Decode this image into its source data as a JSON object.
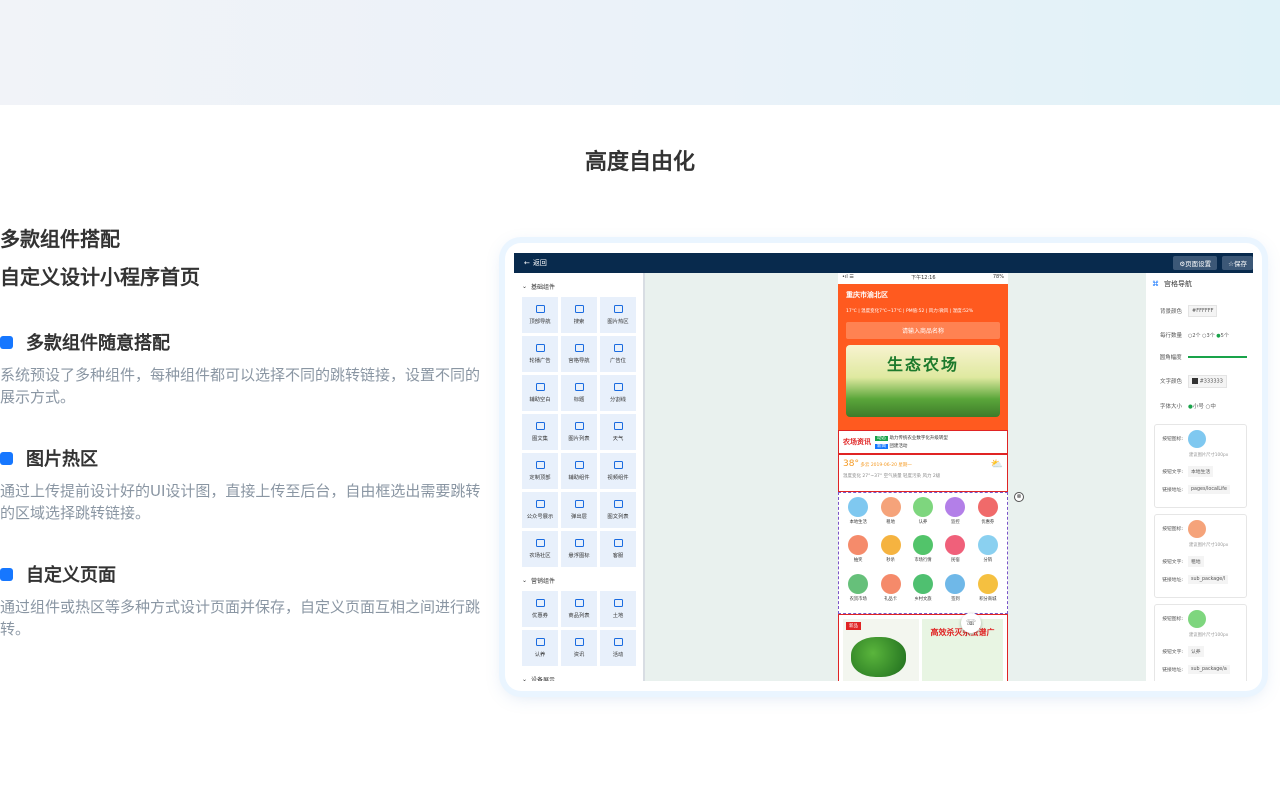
{
  "section": {
    "title": "高度自由化"
  },
  "headline": {
    "line1": "多款组件搭配",
    "line2": "自定义设计小程序首页"
  },
  "features": [
    {
      "title": "多款组件随意搭配",
      "desc": "系统预设了多种组件，每种组件都可以选择不同的跳转链接，设置不同的展示方式。"
    },
    {
      "title": "图片热区",
      "desc": "通过上传提前设计好的UI设计图，直接上传至后台，自由框选出需要跳转的区域选择跳转链接。"
    },
    {
      "title": "自定义页面",
      "desc": "通过组件或热区等多种方式设计页面并保存，自定义页面互相之间进行跳转。"
    }
  ],
  "editor": {
    "back_label": "返回",
    "page_settings_label": "⚙页面设置",
    "save_label": "☆保存",
    "groups": [
      {
        "title": "基础组件",
        "items": [
          "顶部导航",
          "搜索",
          "图片热区",
          "轮播广告",
          "宫格导航",
          "广告位",
          "辅助空白",
          "标题",
          "分割线",
          "图文集",
          "图片列表",
          "天气",
          "定制顶部",
          "辅助组件",
          "视频组件",
          "公众号展示",
          "弹出层",
          "图文列表",
          "农场社区",
          "悬浮图标",
          "客服"
        ]
      },
      {
        "title": "营销组件",
        "items": [
          "优惠券",
          "商品列表",
          "土地",
          "认养",
          "资讯",
          "活动"
        ]
      },
      {
        "title": "设备展示",
        "items": []
      }
    ],
    "phone": {
      "status_left": "•ıl ☰",
      "status_time": "下午12:16",
      "status_battery": "78%",
      "location": "重庆市渝北区",
      "weather_line": "17℃ | 温度变化7℃~17℃ | PM值:52 | 风力:微风 | 湿度:52%",
      "search_placeholder": "请输入商品名称",
      "banner_text": "生态农场",
      "news_logo": "农场资讯",
      "news_items": [
        {
          "tag": "动态",
          "text": "助力传统农业数字化升级转型"
        },
        {
          "tag": "新闻",
          "text": "团建活动"
        }
      ],
      "weather_temp": "38°",
      "weather_info": "多云  2019-06-20  星期一",
      "weather_detail": "温度变化 27°~37°  空气质量 轻度污染  风力 2级",
      "icons": [
        "本地生活",
        "租地",
        "认养",
        "监控",
        "优惠券",
        "抽奖",
        "秒杀",
        "市场行情",
        "民宿",
        "分销",
        "农贸市场",
        "礼品卡",
        "乡村文旅",
        "签到",
        "积分商城"
      ],
      "ad_tag": "新品",
      "ad_text": "高效杀灭杀虫谱广"
    },
    "props": {
      "title": "宫格导航",
      "bg_color_label": "背景颜色",
      "bg_color_value": "#FFFFFF",
      "per_row_label": "每行数量",
      "per_row_options": [
        "2个",
        "3个",
        "5个"
      ],
      "radius_label": "圆角幅度",
      "text_color_label": "文字颜色",
      "text_color_value": "#333333",
      "font_size_label": "字体大小",
      "font_size_options": [
        "小号",
        "中"
      ],
      "links": [
        {
          "icon_label": "按钮图标:",
          "hint": "建议图片尺寸100px",
          "text_label": "按钮文字:",
          "text": "本地生活",
          "url_label": "链接地址:",
          "url": "pages/localLife"
        },
        {
          "icon_label": "按钮图标:",
          "hint": "建议图片尺寸100px",
          "text_label": "按钮文字:",
          "text": "租地",
          "url_label": "链接地址:",
          "url": "sub_package/l"
        },
        {
          "icon_label": "按钮图标:",
          "hint": "建议图片尺寸100px",
          "text_label": "按钮文字:",
          "text": "认养",
          "url_label": "链接地址:",
          "url": "sub_package/a"
        }
      ]
    }
  },
  "colors": {
    "accent": "#1677ff",
    "app_bar": "#082a4d",
    "phone_header": "#ff5a1f"
  }
}
